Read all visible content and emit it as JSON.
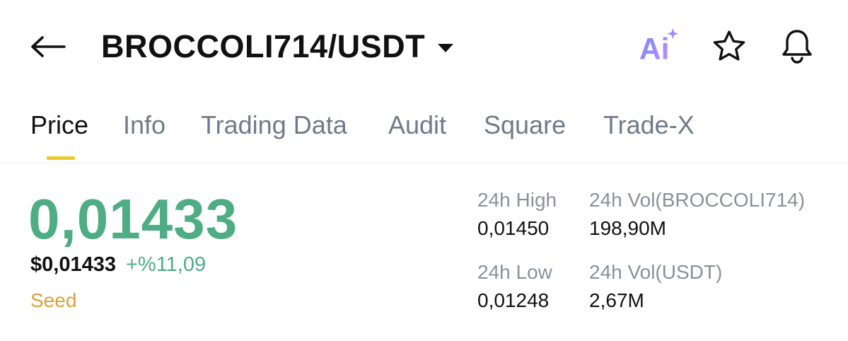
{
  "header": {
    "pair_title": "BROCCOLI714/USDT",
    "icons": {
      "back": "arrow-left-icon",
      "ai": "ai-assistant-icon",
      "favorite": "star-outline-icon",
      "alert": "bell-icon"
    },
    "ai_label": "Ai"
  },
  "tabs": [
    {
      "label": "Price",
      "active": true
    },
    {
      "label": "Info",
      "active": false
    },
    {
      "label": "Trading Data",
      "active": false
    },
    {
      "label": "Audit",
      "active": false
    },
    {
      "label": "Square",
      "active": false
    },
    {
      "label": "Trade-X",
      "active": false
    }
  ],
  "price": {
    "last": "0,01433",
    "usd": "$0,01433",
    "change": "+%11,09",
    "tag": "Seed"
  },
  "stats": {
    "high": {
      "label": "24h High",
      "value": "0,01450"
    },
    "vol_base": {
      "label": "24h Vol(BROCCOLI714)",
      "value": "198,90M"
    },
    "low": {
      "label": "24h Low",
      "value": "0,01248"
    },
    "vol_quote": {
      "label": "24h Vol(USDT)",
      "value": "2,67M"
    }
  },
  "colors": {
    "up_green": "#4ead84",
    "accent_yellow": "#f0c928",
    "seed_gold": "#d8a33a",
    "muted_gray": "#707a8a",
    "ai_gradient_start": "#6f8cff",
    "ai_gradient_end": "#c48bff"
  }
}
